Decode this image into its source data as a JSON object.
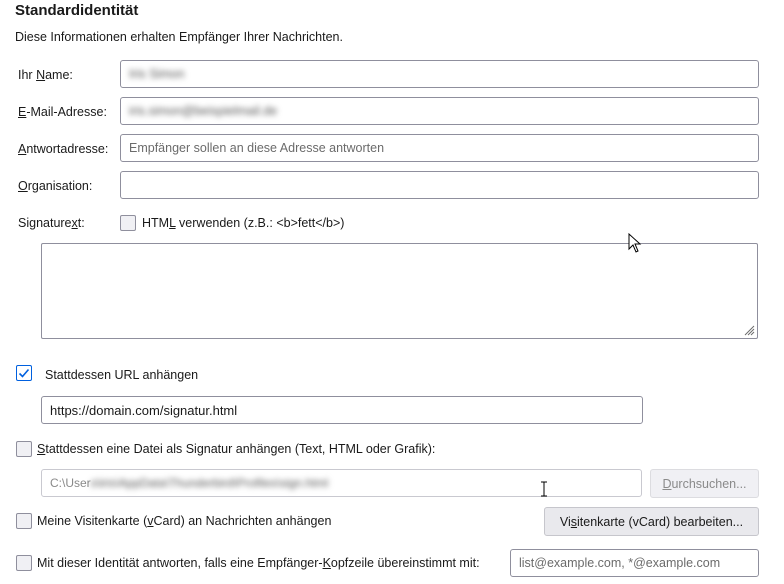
{
  "section": {
    "title": "Standardidentität",
    "description": "Diese Informationen erhalten Empfänger Ihrer Nachrichten."
  },
  "fields": {
    "name": {
      "label_pre": "Ihr ",
      "label_key": "N",
      "label_post": "ame:",
      "value": "Iris Simon"
    },
    "email": {
      "label_pre": "",
      "label_key": "E",
      "label_post": "-Mail-Adresse:",
      "value": "iris.simon@beispielmail.de"
    },
    "reply": {
      "label_pre": "",
      "label_key": "A",
      "label_post": "ntwortadresse:",
      "placeholder": "Empfänger sollen an diese Adresse antworten"
    },
    "org": {
      "label_pre": "",
      "label_key": "O",
      "label_post": "rganisation:",
      "value": ""
    }
  },
  "signature": {
    "label_pre": "Signature",
    "label_key": "x",
    "label_post": "t:",
    "html_label_pre": "HTM",
    "html_label_key": "L",
    "html_label_post": " verwenden (z.B.: <b>fett</b>)",
    "html_checked": false
  },
  "url_option": {
    "label": "Stattdessen URL anhängen",
    "checked": true,
    "value": "https://domain.com/signatur.html"
  },
  "file_option": {
    "label_pre": "",
    "label_key": "S",
    "label_post": "tattdessen eine Datei als Signatur anhängen (Text, HTML oder Grafik):",
    "checked": false,
    "path_prefix": "C:\\User",
    "path_blur": "s\\iris\\AppData\\Thunderbird\\Profiles\\sign.html",
    "browse_key": "D",
    "browse_post": "urchsuchen..."
  },
  "vcard": {
    "label_pre": "Meine Visitenkarte (",
    "label_key": "v",
    "label_post": "Card) an Nachrichten anhängen",
    "checked": false,
    "button_pre": "Vi",
    "button_key": "s",
    "button_post": "itenkarte (vCard) bearbeiten..."
  },
  "reply_match": {
    "label_pre": "Mit dieser Identität antworten, falls eine Empfänger-",
    "label_key": "K",
    "label_post": "opfzeile übereinstimmt mit:",
    "checked": false,
    "placeholder": "list@example.com, *@example.com"
  }
}
